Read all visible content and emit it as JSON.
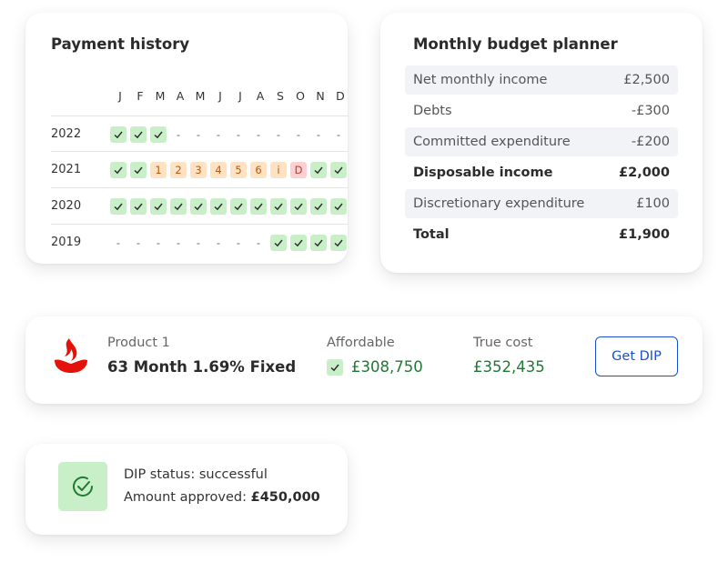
{
  "payment_history": {
    "title": "Payment history",
    "months": [
      "J",
      "F",
      "M",
      "A",
      "M",
      "J",
      "J",
      "A",
      "S",
      "O",
      "N",
      "D"
    ],
    "years": [
      {
        "year": "2022",
        "cells": [
          "ok",
          "ok",
          "ok",
          "-",
          "-",
          "-",
          "-",
          "-",
          "-",
          "-",
          "-",
          "-"
        ]
      },
      {
        "year": "2021",
        "cells": [
          "ok",
          "ok",
          "1",
          "2",
          "3",
          "4",
          "5",
          "6",
          "i",
          "D",
          "ok",
          "ok"
        ]
      },
      {
        "year": "2020",
        "cells": [
          "ok",
          "ok",
          "ok",
          "ok",
          "ok",
          "ok",
          "ok",
          "ok",
          "ok",
          "ok",
          "ok",
          "ok"
        ]
      },
      {
        "year": "2019",
        "cells": [
          "-",
          "-",
          "-",
          "-",
          "-",
          "-",
          "-",
          "-",
          "ok",
          "ok",
          "ok",
          "ok"
        ]
      }
    ]
  },
  "budget": {
    "title": "Monthly budget planner",
    "rows": [
      {
        "label": "Net monthly income",
        "value": "£2,500"
      },
      {
        "label": "Debts",
        "value": "-£300"
      },
      {
        "label": "Committed expenditure",
        "value": "-£200"
      },
      {
        "label": "Disposable income",
        "value": "£2,000"
      },
      {
        "label": "Discretionary expenditure",
        "value": "£100"
      },
      {
        "label": "Total",
        "value": "£1,900"
      }
    ]
  },
  "product": {
    "label": "Product 1",
    "name": "63 Month 1.69% Fixed",
    "affordable_label": "Affordable",
    "affordable_value": "£308,750",
    "true_cost_label": "True cost",
    "true_cost_value": "£352,435",
    "button": "Get DIP",
    "logo_icon": "flame-logo-icon",
    "brand_color": "#e3120b"
  },
  "dip": {
    "status_text": "DIP status: successful",
    "amount_label": "Amount approved: ",
    "amount_value": "£450,000",
    "icon": "check-circle-icon"
  },
  "colors": {
    "ok": "#c8efc8",
    "late": "#fde3c3",
    "default": "#fbd0d0",
    "green_text": "#1f7a34",
    "button_blue": "#1b4fd1"
  }
}
